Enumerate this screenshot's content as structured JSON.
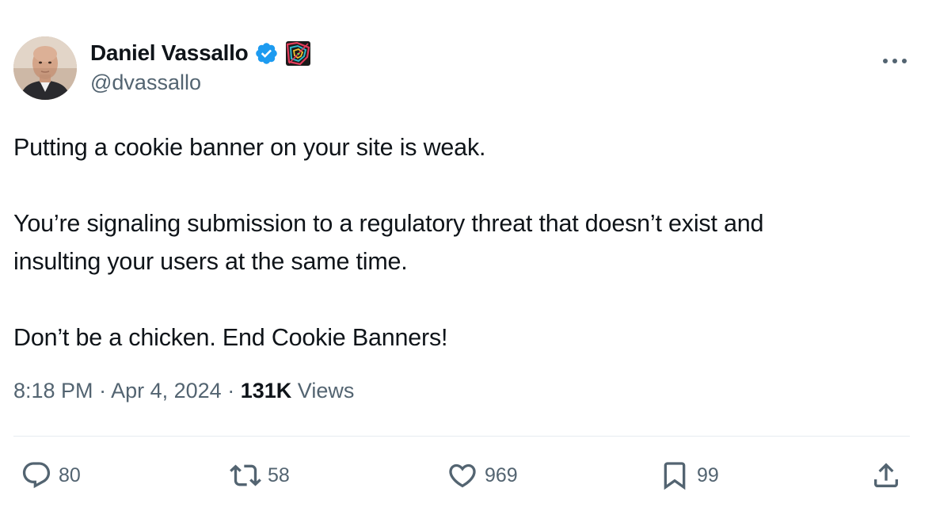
{
  "author": {
    "display_name": "Daniel Vassallo",
    "handle": "@dvassallo",
    "verified": true,
    "verified_color": "#1d9bf0"
  },
  "icons": {
    "more": "more-horizontal-icon",
    "reply": "reply-icon",
    "retweet": "retweet-icon",
    "like": "heart-icon",
    "bookmark": "bookmark-icon",
    "share": "share-icon"
  },
  "tweet": {
    "paragraphs": [
      "Putting a cookie banner on your site is weak.",
      "You’re signaling submission to a regulatory threat that doesn’t exist and",
      "insulting your users at the same time.",
      "Don’t be a chicken. End Cookie Banners!"
    ],
    "time": "8:18 PM",
    "separator": "·",
    "date": "Apr 4, 2024",
    "views_count": "131K",
    "views_label": "Views"
  },
  "actions": {
    "replies": "80",
    "retweets": "58",
    "likes": "969",
    "bookmarks": "99"
  },
  "colors": {
    "text_primary": "#0f1419",
    "text_secondary": "#536471",
    "divider": "#e6ecf0"
  }
}
